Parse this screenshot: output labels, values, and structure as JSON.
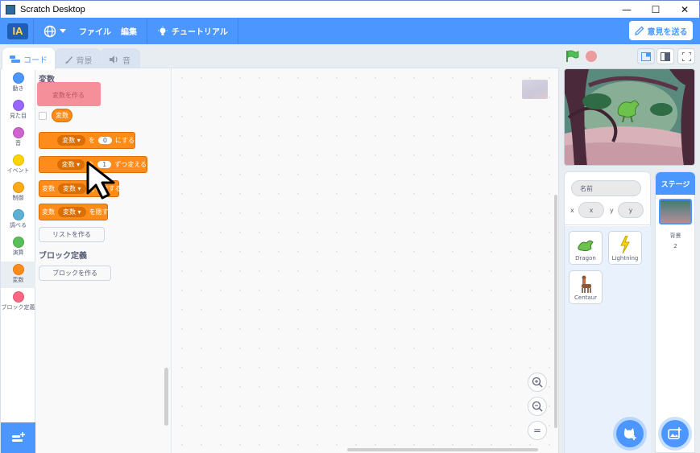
{
  "window": {
    "title": "Scratch Desktop",
    "controls": [
      "—",
      "☐",
      "✕"
    ]
  },
  "menubar": {
    "logo_text": "IA",
    "items": [
      "ファイル",
      "編集"
    ],
    "tutorial": "チュートリアル",
    "feedback": "意見を送る"
  },
  "tabs": [
    "コード",
    "背景",
    "音"
  ],
  "categories": [
    {
      "label": "動き",
      "color": "#4c97ff"
    },
    {
      "label": "見た目",
      "color": "#9966ff"
    },
    {
      "label": "音",
      "color": "#cf63cf"
    },
    {
      "label": "イベント",
      "color": "#ffd500"
    },
    {
      "label": "制御",
      "color": "#ffab19"
    },
    {
      "label": "調べる",
      "color": "#5cb1d6"
    },
    {
      "label": "演算",
      "color": "#59c059"
    },
    {
      "label": "変数",
      "color": "#ff8c1a"
    },
    {
      "label": "ブロック定義",
      "color": "#ff6680"
    }
  ],
  "palette": {
    "section_variables": "変数",
    "make_variable": "変数を作る",
    "var_reporter": "変数",
    "block_set": {
      "dropdown": "変数",
      "to": "を",
      "value": "0",
      "suffix": "にする"
    },
    "block_change": {
      "dropdown": "変数",
      "to": "を",
      "value": "1",
      "suffix": "ずつ変える"
    },
    "block_show": {
      "prefix": "変数",
      "dropdown": "変数",
      "suffix": "を表示する"
    },
    "block_hide": {
      "prefix": "変数",
      "dropdown": "変数",
      "suffix": "を隠す"
    },
    "make_list": "リストを作る",
    "section_my_blocks": "ブロック定義",
    "make_block": "ブロックを作る"
  },
  "canvas": {
    "zoom_in": "+",
    "zoom_out": "−",
    "zoom_reset": "="
  },
  "sprite_info": {
    "name_placeholder": "名前",
    "x_label": "x",
    "x_placeholder": "x",
    "y_label": "y",
    "y_placeholder": "y"
  },
  "sprites": [
    "Dragon",
    "Lightning",
    "Centaur"
  ],
  "stage_panel": {
    "tab": "ステージ",
    "backdrops_label": "背景",
    "backdrops_count": "2"
  }
}
